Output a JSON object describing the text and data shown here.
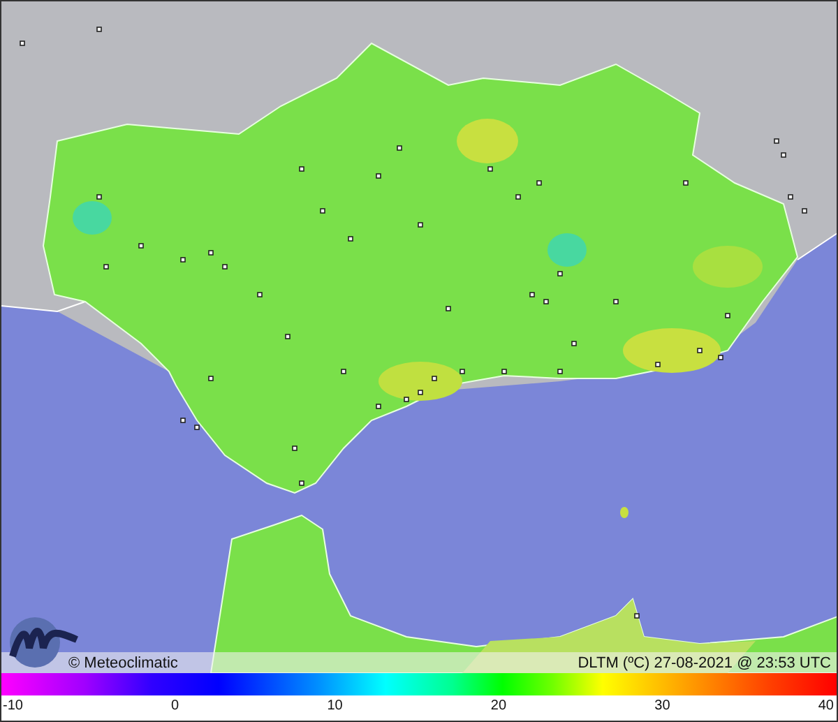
{
  "map": {
    "logo_text": "© Meteoclimatic",
    "caption": "DLTM (ºC)  27-08-2021 @ 23:53 UTC"
  },
  "color_scale": {
    "ticks": [
      "-10",
      "0",
      "10",
      "20",
      "30",
      "40"
    ]
  }
}
